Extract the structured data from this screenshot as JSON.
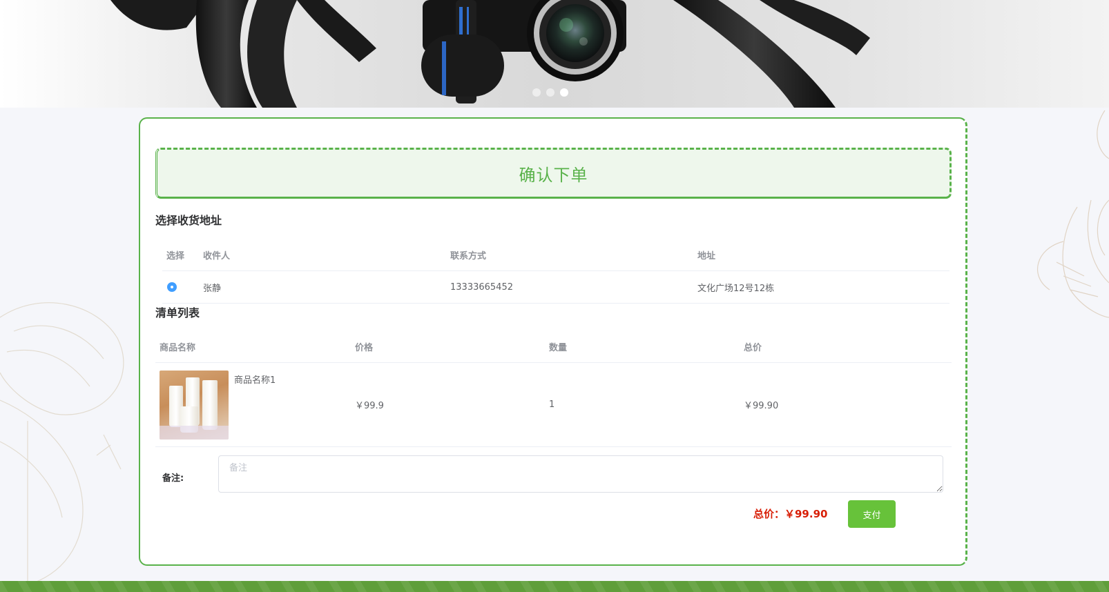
{
  "banner": {
    "active_dot": 3,
    "dot_count": 3
  },
  "order": {
    "title": "确认下单",
    "address_section_title": "选择收货地址",
    "address_table": {
      "columns": [
        "选择",
        "收件人",
        "联系方式",
        "地址"
      ],
      "rows": [
        {
          "selected": true,
          "recipient": "张静",
          "phone": "13333665452",
          "address": "文化广场12号12栋"
        }
      ]
    },
    "list_section_title": "清单列表",
    "goods_table": {
      "columns": [
        "商品名称",
        "价格",
        "数量",
        "总价"
      ],
      "rows": [
        {
          "name": "商品名称1",
          "price": "￥99.9",
          "quantity": "1",
          "subtotal": "￥99.90"
        }
      ]
    },
    "note": {
      "label": "备注:",
      "placeholder": "备注",
      "value": ""
    },
    "total_label": "总价：￥99.90",
    "pay_button": "支付"
  },
  "colors": {
    "accent_green": "#59b24a",
    "title_bg": "#eef7ec",
    "pay_button": "#67c23a",
    "total_red": "#d81e06",
    "radio_blue": "#409eff"
  }
}
